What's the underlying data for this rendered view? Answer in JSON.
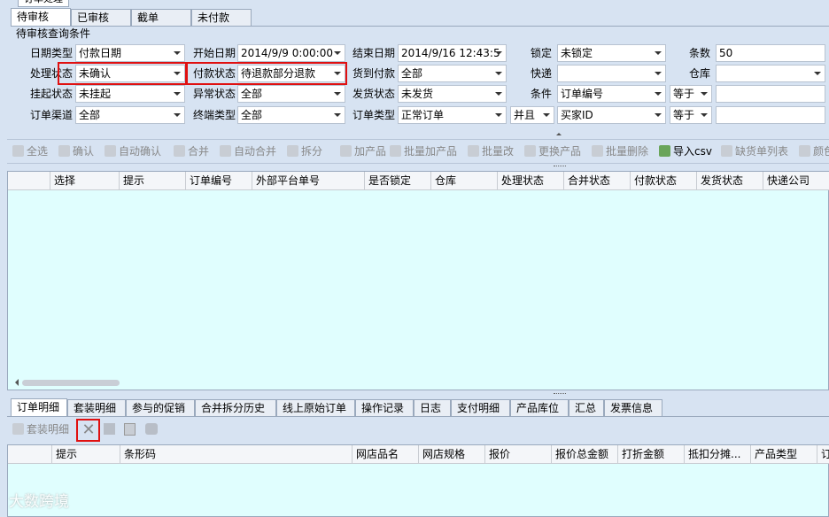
{
  "window_title": "订单处理",
  "top_tabs": [
    "待审核",
    "已审核",
    "截单",
    "未付款"
  ],
  "query_group_title": "待审核查询条件",
  "filters": {
    "date_type": {
      "label": "日期类型",
      "value": "付款日期"
    },
    "start_date": {
      "label": "开始日期",
      "value": "2014/9/9 0:00:00"
    },
    "end_date": {
      "label": "结束日期",
      "value": "2014/9/16 12:43:5"
    },
    "lock": {
      "label": "锁定",
      "value": "未锁定"
    },
    "count": {
      "label": "条数",
      "value": "50"
    },
    "process_status": {
      "label": "处理状态",
      "value": "未确认"
    },
    "payment_status": {
      "label": "付款状态",
      "value": "待退款部分退款"
    },
    "cod": {
      "label": "货到付款",
      "value": "全部"
    },
    "express": {
      "label": "快递",
      "value": ""
    },
    "warehouse": {
      "label": "仓库",
      "value": ""
    },
    "hold_status": {
      "label": "挂起状态",
      "value": "未挂起"
    },
    "exception_status": {
      "label": "异常状态",
      "value": "全部"
    },
    "ship_status": {
      "label": "发货状态",
      "value": "未发货"
    },
    "condition1": {
      "label": "条件",
      "field": "订单编号",
      "op": "等于",
      "value": ""
    },
    "channel": {
      "label": "订单渠道",
      "value": "全部"
    },
    "terminal": {
      "label": "终端类型",
      "value": "全部"
    },
    "order_type": {
      "label": "订单类型",
      "value": "正常订单"
    },
    "logic": "并且",
    "condition2": {
      "field": "买家ID",
      "op": "等于",
      "value": ""
    }
  },
  "toolbar": [
    {
      "label": "全选",
      "enabled": false
    },
    {
      "label": "确认",
      "enabled": false
    },
    {
      "label": "自动确认",
      "enabled": false
    },
    {
      "label": "合并",
      "enabled": false
    },
    {
      "label": "自动合并",
      "enabled": false
    },
    {
      "label": "拆分",
      "enabled": false
    },
    {
      "label": "加产品",
      "enabled": false
    },
    {
      "label": "批量加产品",
      "enabled": false
    },
    {
      "label": "批量改",
      "enabled": false
    },
    {
      "label": "更换产品",
      "enabled": false
    },
    {
      "label": "批量删除",
      "enabled": false
    },
    {
      "label": "导入csv",
      "enabled": true
    },
    {
      "label": "缺货单列表",
      "enabled": false
    },
    {
      "label": "颜色",
      "enabled": false
    }
  ],
  "main_grid_columns": [
    "选择",
    "提示",
    "订单编号",
    "外部平台单号",
    "是否锁定",
    "仓库",
    "处理状态",
    "合并状态",
    "付款状态",
    "发货状态",
    "快递公司"
  ],
  "bottom_tabs": [
    "订单明细",
    "套装明细",
    "参与的促销",
    "合并拆分历史",
    "线上原始订单",
    "操作记录",
    "日志",
    "支付明细",
    "产品库位",
    "汇总",
    "发票信息"
  ],
  "bottom_toolbar": {
    "suit_detail": "套装明细"
  },
  "detail_grid_columns": [
    "提示",
    "条形码",
    "网店品名",
    "网店规格",
    "报价",
    "报价总金额",
    "打折金额",
    "抵扣分摊...",
    "产品类型",
    "订"
  ],
  "watermark": "大数跨境"
}
